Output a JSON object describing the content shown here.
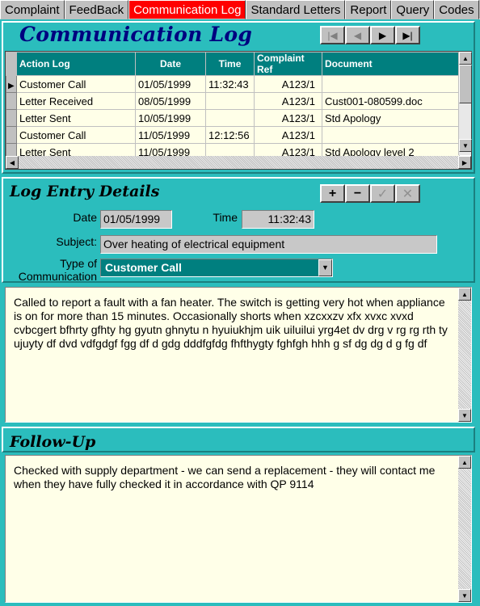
{
  "tabs": [
    "Complaint",
    "FeedBack",
    "Communication Log",
    "Standard Letters",
    "Report",
    "Query",
    "Codes"
  ],
  "active_tab": "Communication Log",
  "header": {
    "title": "Communication Log"
  },
  "grid": {
    "columns": [
      "Action Log",
      "Date",
      "Time",
      "Complaint Ref",
      "Document"
    ],
    "rows": [
      [
        "Customer Call",
        "01/05/1999",
        "11:32:43",
        "A123/1",
        ""
      ],
      [
        "Letter Received",
        "08/05/1999",
        "",
        "A123/1",
        "Cust001-080599.doc"
      ],
      [
        "Letter Sent",
        "10/05/1999",
        "",
        "A123/1",
        "Std Apology"
      ],
      [
        "Customer Call",
        "11/05/1999",
        "12:12:56",
        "A123/1",
        ""
      ],
      [
        "Letter Sent",
        "11/05/1999",
        "",
        "A123/1",
        "Std Apology level 2"
      ]
    ]
  },
  "details": {
    "title": "Log Entry Details",
    "date_label": "Date",
    "date_value": "01/05/1999",
    "time_label": "Time",
    "time_value": "11:32:43",
    "subject_label": "Subject:",
    "subject_value": "Over heating of electrical equipment",
    "type_label_1": "Type of",
    "type_label_2": "Communication",
    "type_value": "Customer Call",
    "notes": "Called to report a fault with a fan heater. The switch is getting very hot when appliance is on for more than 15 minutes.  Occasionally shorts when xzcxxzv xfx xvxc xvxd cvbcgert bfhrty gfhty hg gyutn ghnytu n hyuiukhjm uik uiluilui yrg4et dv drg v rg rg rth ty ujuyty df dvd vdfgdgf fgg df d gdg dddfgfdg fhfthygty fghfgh hhh g sf  dg dg d g fg df"
  },
  "followup": {
    "title": "Follow-Up",
    "text": "Checked with supply department - we can send a replacement - they will contact me when they have fully checked it in accordance with QP 9114"
  },
  "colors": {
    "background": "#2bbdbd",
    "active_tab": "#ff0000",
    "grid_header": "#007f7f",
    "title": "#00007f"
  }
}
